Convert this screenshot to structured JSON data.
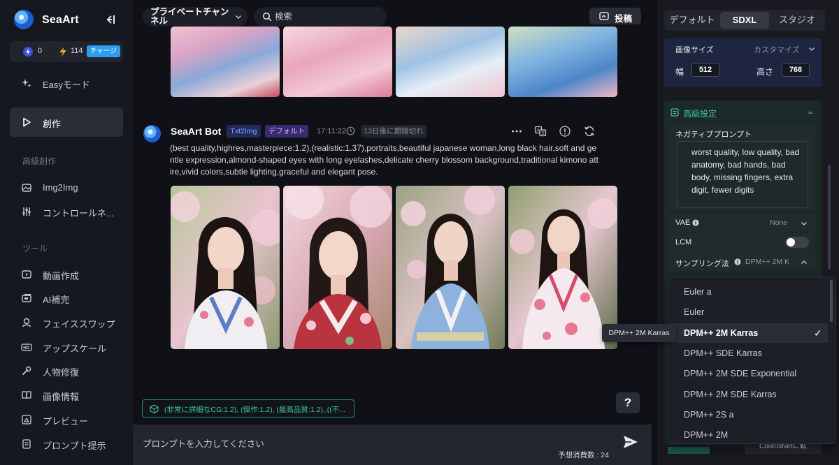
{
  "app": {
    "name": "SeaArt",
    "credit_a": "0",
    "credit_b": "114",
    "charge_label": "チャージ"
  },
  "sidebar": {
    "easy_mode": "Easyモード",
    "create": "創作",
    "section_advanced": "高級創作",
    "img2img": "Img2Img",
    "controlnet": "コントロールネ...",
    "section_tools": "ツール",
    "tools": [
      "動画作成",
      "AI補完",
      "フェイススワップ",
      "アップスケール",
      "人物修復",
      "画像情報",
      "プレビュー",
      "プロンプト提示"
    ]
  },
  "header": {
    "channel": "プライベートチャンネル",
    "search_placeholder": "検索",
    "post_label": "投稿"
  },
  "message": {
    "bot_name": "SeaArt Bot",
    "tag_mode": "Txt2Img",
    "tag_model": "デフォルト",
    "time": "17:11:22",
    "expiry": "13日後に期限切れ",
    "prompt": "(best quality,highres,masterpiece:1.2),(realistic:1.37),portraits,beautiful japanese woman,long black hair,soft and gentle expression,almond-shaped eyes with long eyelashes,delicate cherry blossom background,traditional kimono attire,vivid colors,subtle lighting,graceful and elegant pose."
  },
  "composer": {
    "suggestion": "(非常に詳細なCG:1.2), (傑作:1.2), (最高品質:1.2),,((不...",
    "help": "?",
    "placeholder": "プロンプトを入力してください",
    "cost": "予想消費数 : 24"
  },
  "right_panel": {
    "tabs": [
      "デフォルト",
      "SDXL",
      "スタジオ"
    ],
    "active_tab": "SDXL",
    "image_size_label": "画像サイズ",
    "image_size_value": "カスタマイズ",
    "width_label": "幅",
    "width_value": "512",
    "height_label": "高さ",
    "height_value": "768",
    "advanced_title": "高級設定",
    "negative_label": "ネガティブプロンプト",
    "negative_text": "worst quality, low quality, bad anatomy, bad hands, bad body, missing fingers, extra digit, fewer digits",
    "vae_label": "VAE",
    "vae_value": "None",
    "lcm_label": "LCM",
    "lcm_on": false,
    "sampler_label": "サンプリング法",
    "sampler_value": "DPM++ 2M K",
    "controlnet_chip": "ControlNetに転"
  },
  "sampler_dropdown": {
    "options": [
      "Euler a",
      "Euler",
      "DPM++ 2M Karras",
      "DPM++ SDE Karras",
      "DPM++ 2M SDE Exponential",
      "DPM++ 2M SDE Karras",
      "DPM++ 2S a",
      "DPM++ 2M"
    ],
    "selected": "DPM++ 2M Karras",
    "check": "✓",
    "tooltip": "DPM++ 2M Karras"
  },
  "colors": {
    "accent_teal": "#3fc2a3",
    "accent_blue": "#2c9df0",
    "panel_bg": "#181a20"
  }
}
